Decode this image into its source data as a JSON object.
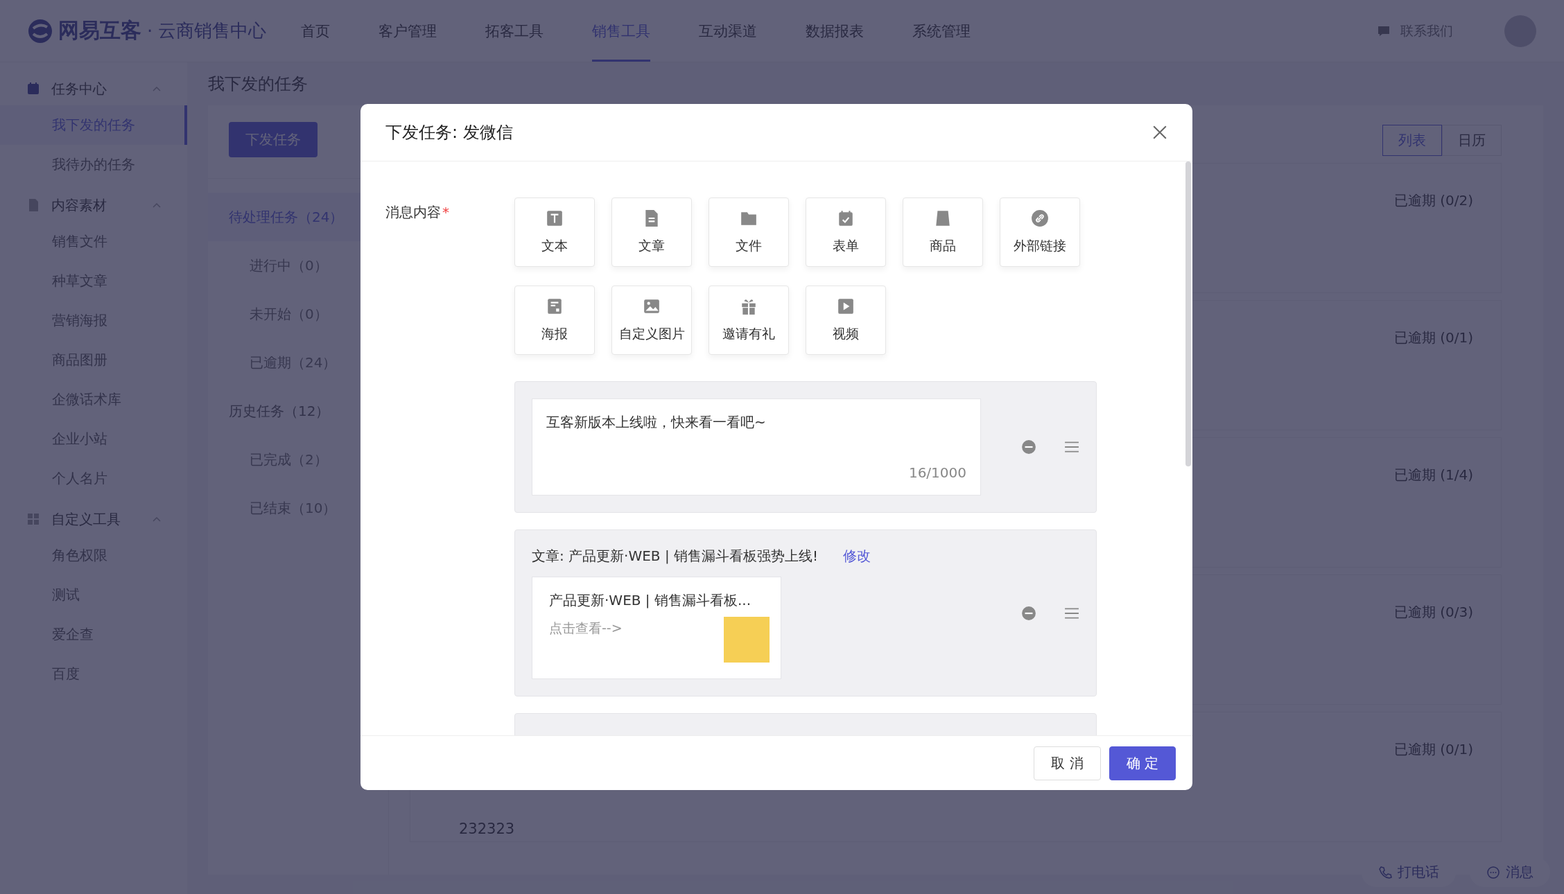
{
  "nav": {
    "brand": "网易互客",
    "separator": "·",
    "product": "云商销售中心",
    "items": [
      {
        "label": "首页",
        "selected": false
      },
      {
        "label": "客户管理",
        "selected": false
      },
      {
        "label": "拓客工具",
        "selected": false
      },
      {
        "label": "销售工具",
        "selected": true
      },
      {
        "label": "互动渠道",
        "selected": false
      },
      {
        "label": "数据报表",
        "selected": false
      },
      {
        "label": "系统管理",
        "selected": false
      }
    ],
    "contact": "联系我们"
  },
  "sidebar": {
    "groups": [
      {
        "kind": "calendar",
        "title": "任务中心",
        "expanded": true,
        "items": [
          {
            "label": "我下发的任务",
            "selected": true
          },
          {
            "label": "我待办的任务",
            "selected": false
          }
        ]
      },
      {
        "kind": "document",
        "title": "内容素材",
        "expanded": true,
        "items": [
          {
            "label": "销售文件",
            "selected": false
          },
          {
            "label": "种草文章",
            "selected": false
          },
          {
            "label": "营销海报",
            "selected": false
          },
          {
            "label": "商品图册",
            "selected": false
          },
          {
            "label": "企微话术库",
            "selected": false
          },
          {
            "label": "企业小站",
            "selected": false
          },
          {
            "label": "个人名片",
            "selected": false
          }
        ]
      },
      {
        "kind": "grid",
        "title": "自定义工具",
        "expanded": true,
        "items": [
          {
            "label": "角色权限",
            "selected": false
          },
          {
            "label": "测试",
            "selected": false
          },
          {
            "label": "爱企查",
            "selected": false
          },
          {
            "label": "百度",
            "selected": false
          }
        ]
      }
    ]
  },
  "page": {
    "title": "我下发的任务",
    "issue_button": "下发任务",
    "filters": [
      {
        "label": "待处理任务（24）",
        "selected": true,
        "children": [
          {
            "label": "进行中（0）",
            "selected": false
          },
          {
            "label": "未开始（0）",
            "selected": false
          },
          {
            "label": "已逾期（24）",
            "selected": false
          }
        ]
      },
      {
        "label": "历史任务（12）",
        "selected": false,
        "children": [
          {
            "label": "已完成（2）",
            "selected": false
          },
          {
            "label": "已结束（10）",
            "selected": false
          }
        ]
      }
    ],
    "view_toggle": [
      {
        "label": "列表",
        "selected": true
      },
      {
        "label": "日历",
        "selected": false
      }
    ],
    "task_cards": [
      {
        "status": "已逾期 (0/2)"
      },
      {
        "status": "已逾期 (0/1)"
      },
      {
        "status": "已逾期 (1/4)"
      },
      {
        "status": "已逾期 (0/3)"
      },
      {
        "status": "已逾期 (0/1)",
        "title": "232323"
      }
    ],
    "float_buttons": [
      {
        "kind": "phone",
        "label": "打电话"
      },
      {
        "kind": "chat",
        "label": "消息"
      }
    ]
  },
  "modal": {
    "title": "下发任务: 发微信",
    "field_label": "消息内容",
    "required_mark": "*",
    "content_types": [
      {
        "kind": "text",
        "label": "文本"
      },
      {
        "kind": "article",
        "label": "文章"
      },
      {
        "kind": "file",
        "label": "文件"
      },
      {
        "kind": "form",
        "label": "表单"
      },
      {
        "kind": "product",
        "label": "商品"
      },
      {
        "kind": "link",
        "label": "外部链接"
      },
      {
        "kind": "poster",
        "label": "海报"
      },
      {
        "kind": "image",
        "label": "自定义图片"
      },
      {
        "kind": "gift",
        "label": "邀请有礼"
      },
      {
        "kind": "video",
        "label": "视频"
      }
    ],
    "messages": [
      {
        "kind": "text",
        "value": "互客新版本上线啦，快来看一看吧~",
        "counter": "16/1000"
      },
      {
        "kind": "article",
        "heading": "文章: 产品更新·WEB | 销售漏斗看板强势上线!",
        "edit_link": "修改",
        "card_title": "产品更新·WEB | 销售漏斗看板...",
        "card_hint": "点击查看-->"
      },
      {
        "kind": "empty"
      }
    ],
    "cancel": "取 消",
    "confirm": "确 定"
  }
}
